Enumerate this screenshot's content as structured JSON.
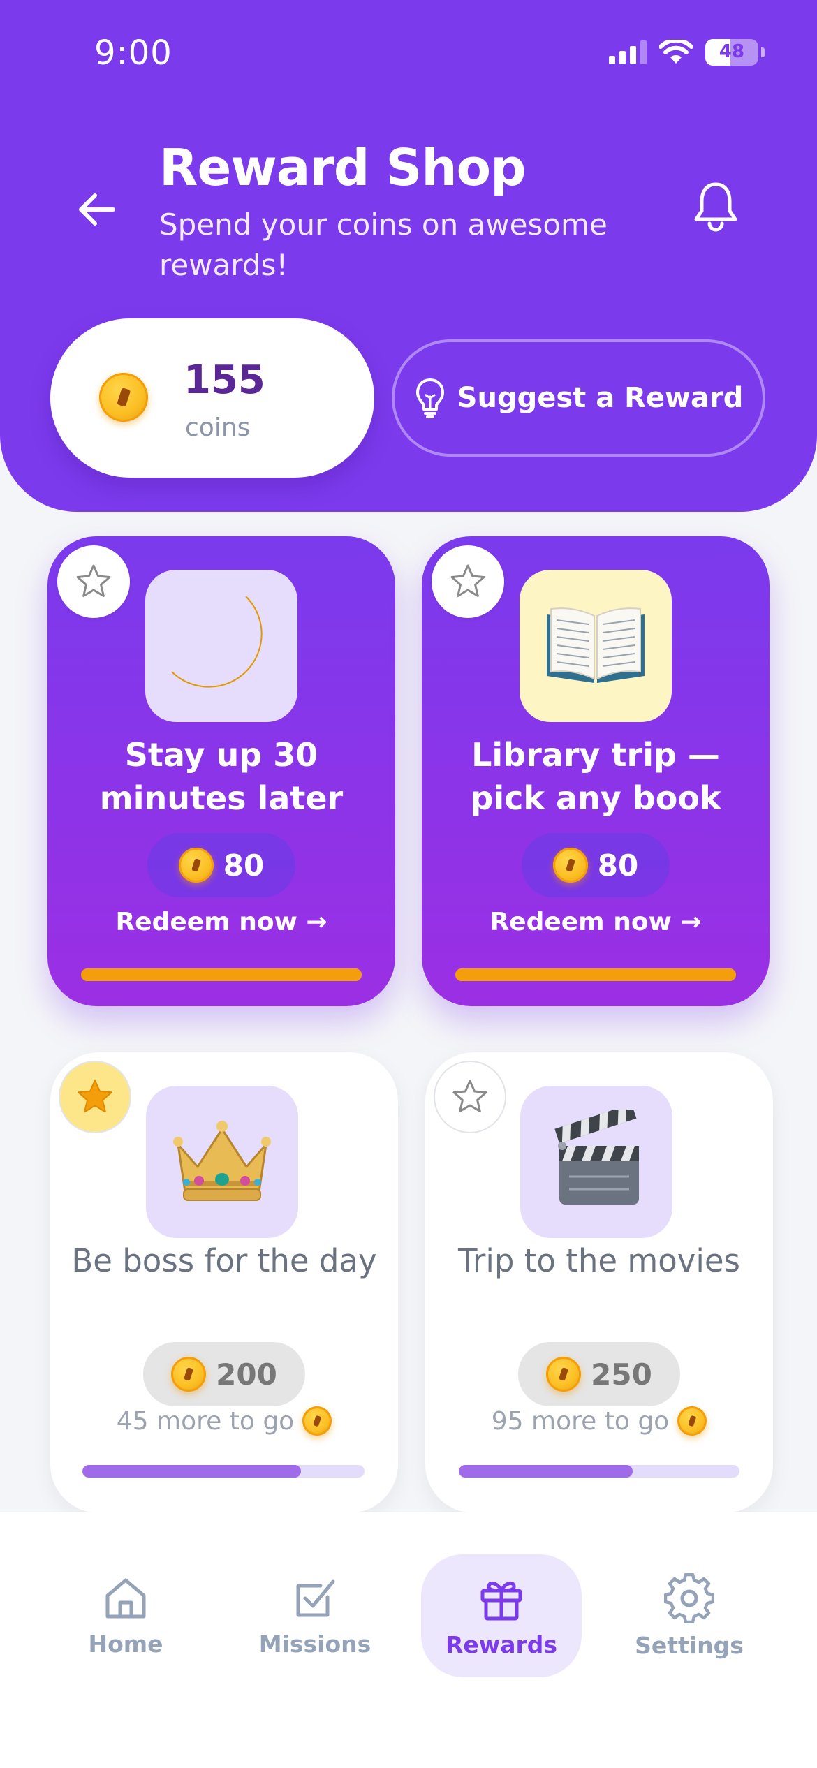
{
  "status_bar": {
    "time": "9:00",
    "battery": "48",
    "battery_level": 0.48
  },
  "header": {
    "title": "Reward Shop",
    "subtitle": "Spend your coins on awesome rewards!",
    "balance": "155",
    "balance_unit": "coins",
    "suggest_label": "Suggest a Reward"
  },
  "rewards": [
    {
      "title": "Stay up 30 minutes later",
      "icon": "crescent-moon",
      "cost": "80",
      "action": "Redeem now →",
      "affordable": true,
      "favorite": false,
      "progress": 1.0,
      "tile_color": "#e6dcfb"
    },
    {
      "title": "Library trip — pick any book",
      "icon": "open-book",
      "cost": "80",
      "action": "Redeem now →",
      "affordable": true,
      "favorite": false,
      "progress": 1.0,
      "tile_color": "#fdf5c4"
    },
    {
      "title": "Be boss for the day",
      "icon": "crown",
      "cost": "200",
      "remaining": "45 more to go",
      "affordable": false,
      "favorite": true,
      "progress": 0.775,
      "tile_color": "#e6dcfb"
    },
    {
      "title": "Trip to the movies",
      "icon": "clapper-board",
      "cost": "250",
      "remaining": "95 more to go",
      "affordable": false,
      "favorite": false,
      "progress": 0.62,
      "tile_color": "#e6dcfb"
    }
  ],
  "nav": {
    "items": [
      {
        "label": "Home",
        "icon": "home-icon"
      },
      {
        "label": "Missions",
        "icon": "checkbox-icon"
      },
      {
        "label": "Rewards",
        "icon": "gift-icon",
        "active": true
      },
      {
        "label": "Settings",
        "icon": "gear-icon"
      }
    ]
  },
  "colors": {
    "primary": "#7c3aed",
    "accent": "#f59e0b",
    "coin": "#fbbf24",
    "inactive": "#94a3b8"
  }
}
